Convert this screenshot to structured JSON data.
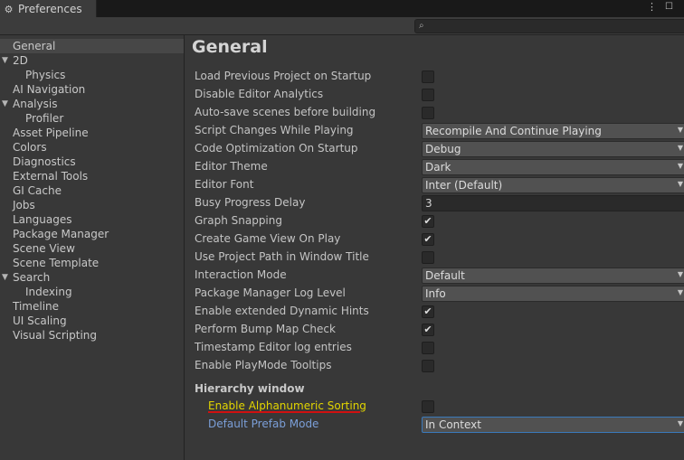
{
  "window": {
    "tab_title": "Preferences",
    "tab_icon": "gear-icon",
    "menu_icon": "kebab-menu-icon",
    "maximize_icon": "maximize-icon"
  },
  "search": {
    "placeholder": "",
    "icon": "search-icon"
  },
  "sidebar": {
    "items": [
      {
        "label": "General",
        "selected": true
      },
      {
        "label": "2D",
        "expandable": true
      },
      {
        "label": "Physics",
        "child": true
      },
      {
        "label": "AI Navigation"
      },
      {
        "label": "Analysis",
        "expandable": true
      },
      {
        "label": "Profiler",
        "child": true
      },
      {
        "label": "Asset Pipeline"
      },
      {
        "label": "Colors"
      },
      {
        "label": "Diagnostics"
      },
      {
        "label": "External Tools"
      },
      {
        "label": "GI Cache"
      },
      {
        "label": "Jobs"
      },
      {
        "label": "Languages"
      },
      {
        "label": "Package Manager"
      },
      {
        "label": "Scene View"
      },
      {
        "label": "Scene Template"
      },
      {
        "label": "Search",
        "expandable": true
      },
      {
        "label": "Indexing",
        "child": true
      },
      {
        "label": "Timeline"
      },
      {
        "label": "UI Scaling"
      },
      {
        "label": "Visual Scripting"
      }
    ]
  },
  "main": {
    "title": "General",
    "settings": [
      {
        "label": "Load Previous Project on Startup",
        "type": "checkbox",
        "checked": false
      },
      {
        "label": "Disable Editor Analytics",
        "type": "checkbox",
        "checked": false
      },
      {
        "label": "Auto-save scenes before building",
        "type": "checkbox",
        "checked": false
      },
      {
        "label": "Script Changes While Playing",
        "type": "dropdown",
        "value": "Recompile And Continue Playing"
      },
      {
        "label": "Code Optimization On Startup",
        "type": "dropdown",
        "value": "Debug"
      },
      {
        "label": "Editor Theme",
        "type": "dropdown",
        "value": "Dark"
      },
      {
        "label": "Editor Font",
        "type": "dropdown",
        "value": "Inter (Default)"
      },
      {
        "label": "Busy Progress Delay",
        "type": "number",
        "value": "3"
      },
      {
        "label": "Graph Snapping",
        "type": "checkbox",
        "checked": true
      },
      {
        "label": "Create Game View On Play",
        "type": "checkbox",
        "checked": true
      },
      {
        "label": "Use Project Path in Window Title",
        "type": "checkbox",
        "checked": false
      },
      {
        "label": "Interaction Mode",
        "type": "dropdown",
        "value": "Default"
      },
      {
        "label": "Package Manager Log Level",
        "type": "dropdown",
        "value": "Info"
      },
      {
        "label": "Enable extended Dynamic Hints",
        "type": "checkbox",
        "checked": true
      },
      {
        "label": "Perform Bump Map Check",
        "type": "checkbox",
        "checked": true
      },
      {
        "label": "Timestamp Editor log entries",
        "type": "checkbox",
        "checked": false
      },
      {
        "label": "Enable PlayMode Tooltips",
        "type": "checkbox",
        "checked": false
      }
    ],
    "hierarchy": {
      "section_title": "Hierarchy window",
      "settings": [
        {
          "label": "Enable Alphanumeric Sorting",
          "type": "checkbox",
          "checked": false,
          "highlight": "yellow"
        },
        {
          "label": "Default Prefab Mode",
          "type": "dropdown",
          "value": "In Context",
          "highlight": "blue"
        }
      ]
    }
  },
  "colors": {
    "background": "#383838",
    "selected": "#474747",
    "highlight_yellow": "#e2d500",
    "highlight_blue": "#7b9fd8",
    "annotation_red": "#d01010",
    "focus_blue": "#3a79bb"
  }
}
